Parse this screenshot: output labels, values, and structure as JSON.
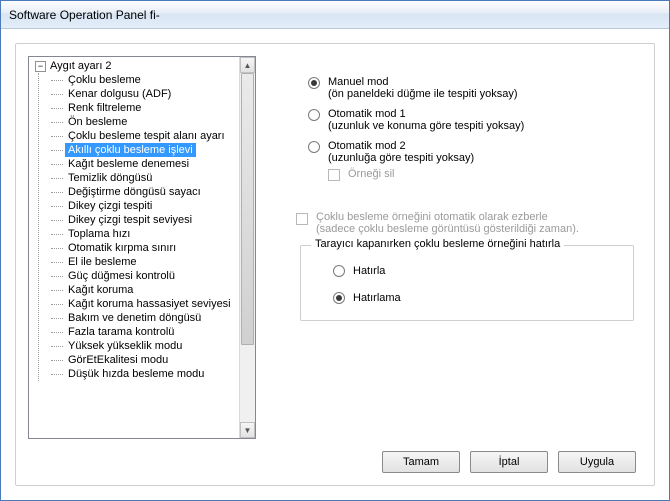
{
  "window": {
    "title": "Software Operation Panel fi-"
  },
  "tree": {
    "parent_label": "Aygıt ayarı 2",
    "expander": "−",
    "selected_index": 5,
    "items": [
      "Çoklu besleme",
      "Kenar dolgusu (ADF)",
      "Renk filtreleme",
      "Ön besleme",
      "Çoklu besleme tespit alanı ayarı",
      "Akıllı çoklu besleme işlevi",
      "Kağıt besleme denemesi",
      "Temizlik döngüsü",
      "Değiştirme döngüsü sayacı",
      "Dikey çizgi tespiti",
      "Dikey çizgi tespit seviyesi",
      "Toplama hızı",
      "Otomatik kırpma sınırı",
      "El ile besleme",
      "Güç düğmesi kontrolü",
      "Kağıt koruma",
      "Kağıt koruma hassasiyet seviyesi",
      "Bakım ve denetim döngüsü",
      "Fazla tarama kontrolü",
      "Yüksek yükseklik modu",
      "GörEtEkalitesi modu",
      "Düşük hızda besleme modu"
    ]
  },
  "modes": {
    "manual": {
      "label": "Manuel mod",
      "sub": "(ön paneldeki düğme ile tespiti yoksay)"
    },
    "auto1": {
      "label": "Otomatik mod 1",
      "sub": "(uzunluk ve konuma göre tespiti yoksay)"
    },
    "auto2": {
      "label": "Otomatik mod 2",
      "sub": "(uzunluğa göre tespiti yoksay)"
    },
    "clear_sample": "Örneği sil",
    "selected": "manual"
  },
  "auto_memorize": {
    "label": "Çoklu besleme örneğini otomatik olarak ezberle",
    "sub": "(sadece çoklu besleme görüntüsü gösterildiği zaman).",
    "enabled": false
  },
  "remember": {
    "legend": "Tarayıcı kapanırken çoklu besleme örneğini hatırla",
    "remember_label": "Hatırla",
    "dont_remember_label": "Hatırlama",
    "selected": "dont"
  },
  "buttons": {
    "ok": "Tamam",
    "cancel": "İptal",
    "apply": "Uygula"
  },
  "scrollbar": {
    "up": "▲",
    "down": "▼"
  }
}
